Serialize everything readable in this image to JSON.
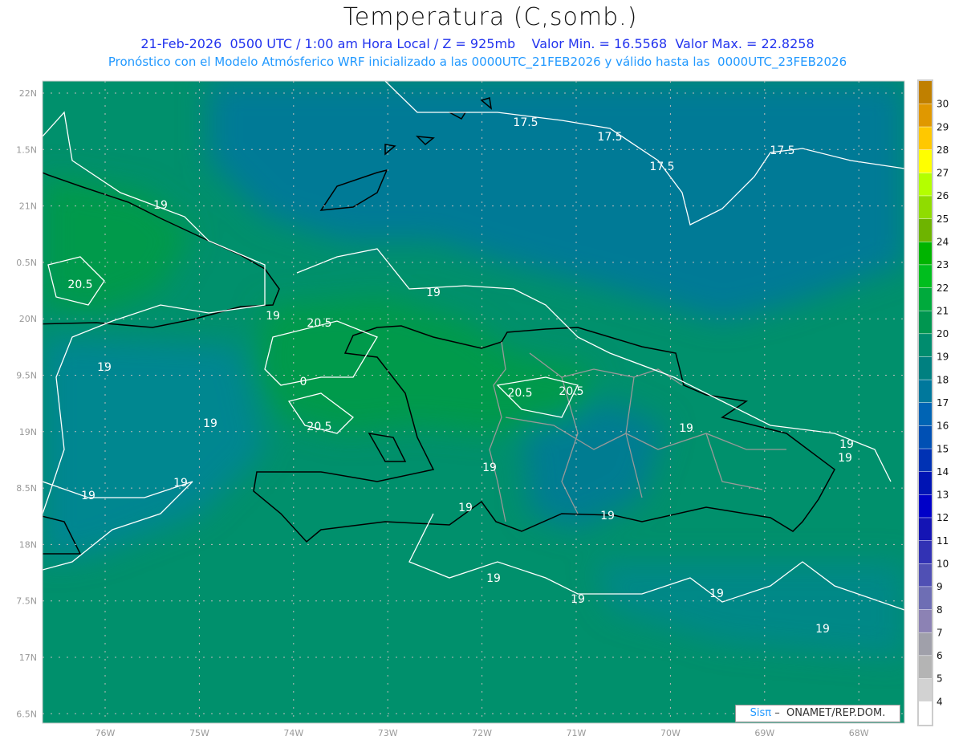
{
  "header": {
    "title": "Temperatura (C,somb.)",
    "subtitle_line1": "21-Feb-2026  0500 UTC / 1:00 am Hora Local / Z = 925mb    Valor Min. = 16.5568  Valor Max. = 22.8258",
    "subtitle_line2": "Pronóstico con el Modelo Atmósferico WRF inicializado a las 0000UTC_21FEB2026 y válido hasta las  0000UTC_23FEB2026"
  },
  "map": {
    "lon_labels": [
      "76W",
      "75W",
      "74W",
      "73W",
      "72W",
      "71W",
      "70W",
      "69W",
      "68W"
    ],
    "lat_labels": [
      "22N",
      "1.5N",
      "21N",
      "0.5N",
      "20N",
      "9.5N",
      "19N",
      "8.5N",
      "18N",
      "7.5N",
      "17N",
      "6.5N"
    ],
    "contour_labels": [
      {
        "text": "17.5"
      },
      {
        "text": "17.5"
      },
      {
        "text": "17.5"
      },
      {
        "text": "17.5"
      },
      {
        "text": "19"
      },
      {
        "text": "19"
      },
      {
        "text": "19"
      },
      {
        "text": "19"
      },
      {
        "text": "19"
      },
      {
        "text": "19"
      },
      {
        "text": "19"
      },
      {
        "text": "19"
      },
      {
        "text": "19"
      },
      {
        "text": "19"
      },
      {
        "text": "19"
      },
      {
        "text": "19"
      },
      {
        "text": "19"
      },
      {
        "text": "19"
      },
      {
        "text": "19"
      },
      {
        "text": "19"
      },
      {
        "text": "19"
      },
      {
        "text": "20.5"
      },
      {
        "text": "20.5"
      },
      {
        "text": "20.5"
      },
      {
        "text": "20.5"
      },
      {
        "text": "20.5"
      },
      {
        "text": "0"
      }
    ],
    "colors": {
      "sea": "#00906c",
      "cool": "#007a96",
      "warm": "#009a4c",
      "coast": "#000000",
      "borders": "#999999",
      "contours": "#ffffff"
    }
  },
  "colorbar": {
    "labels": [
      "30",
      "29",
      "28",
      "27",
      "26",
      "25",
      "24",
      "23",
      "22",
      "21",
      "20",
      "19",
      "18",
      "17",
      "16",
      "15",
      "14",
      "13",
      "12",
      "11",
      "10",
      "9",
      "8",
      "7",
      "6",
      "5",
      "4"
    ],
    "colors": [
      "#c08000",
      "#e09800",
      "#ffc800",
      "#ffff00",
      "#b4ff00",
      "#90dc00",
      "#6eb400",
      "#00b400",
      "#00be1e",
      "#00aa3c",
      "#009650",
      "#008c6e",
      "#008080",
      "#00789c",
      "#0064b4",
      "#0050b4",
      "#0032b4",
      "#0014b4",
      "#0000c8",
      "#1414b4",
      "#3232b4",
      "#5050b4",
      "#6e6eb4",
      "#8c82b4",
      "#a0a0aa",
      "#b4b4b4",
      "#d2d2d2",
      "#ffffff"
    ]
  },
  "credit": {
    "brand": "Sisπ",
    "text": "–  ONAMET/REP.DOM."
  }
}
